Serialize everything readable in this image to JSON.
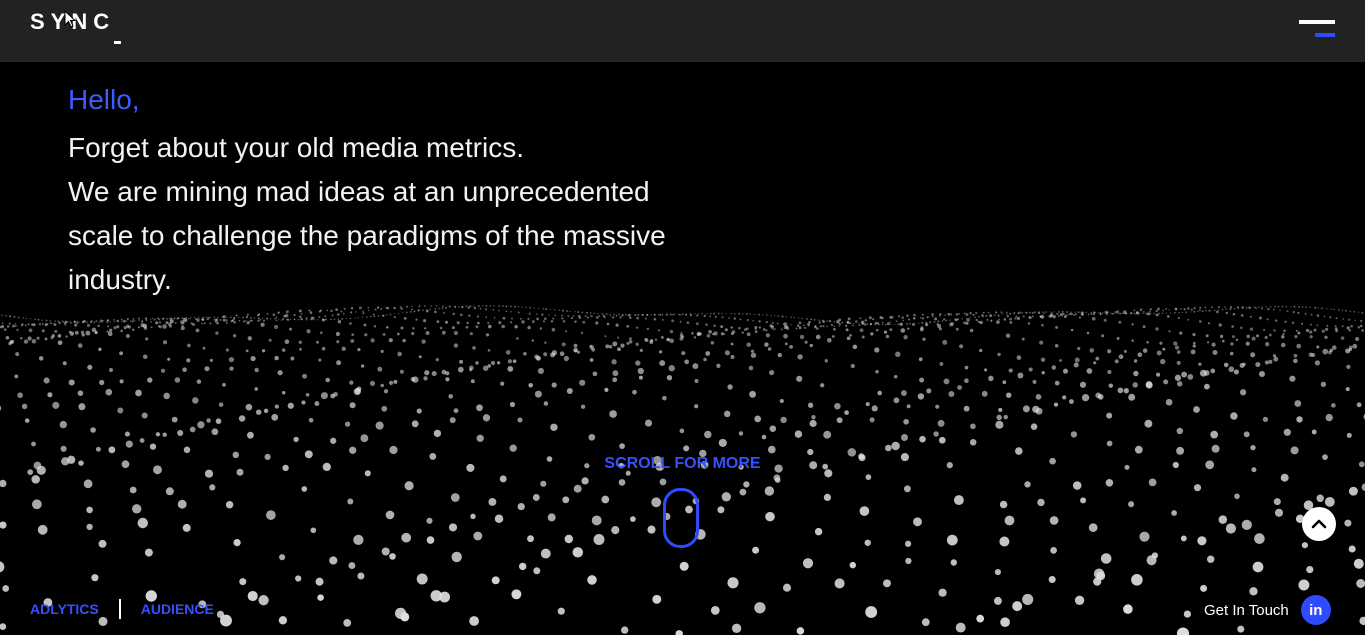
{
  "header": {
    "logo_text": "SYNC",
    "menu_icon": "hamburger-menu-icon"
  },
  "hero": {
    "greeting": "Hello,",
    "lines": [
      "Forget about your old media metrics.",
      "We are mining mad ideas at an unprecedented",
      "scale to challenge the paradigms of the massive",
      "industry."
    ]
  },
  "scroll": {
    "label": "SCROLL FOR MORE",
    "icon": "mouse-scroll-icon"
  },
  "footer": {
    "nav": [
      "ADLYTICS",
      "AUDIENCE"
    ],
    "contact_label": "Get In Touch",
    "social_icon": "linkedin-icon",
    "social_text": "in",
    "back_to_top_icon": "chevron-up-icon"
  },
  "colors": {
    "accent": "#2e4bff",
    "greeting": "#3d5cff",
    "background": "#000000",
    "header_bg": "#222222"
  }
}
